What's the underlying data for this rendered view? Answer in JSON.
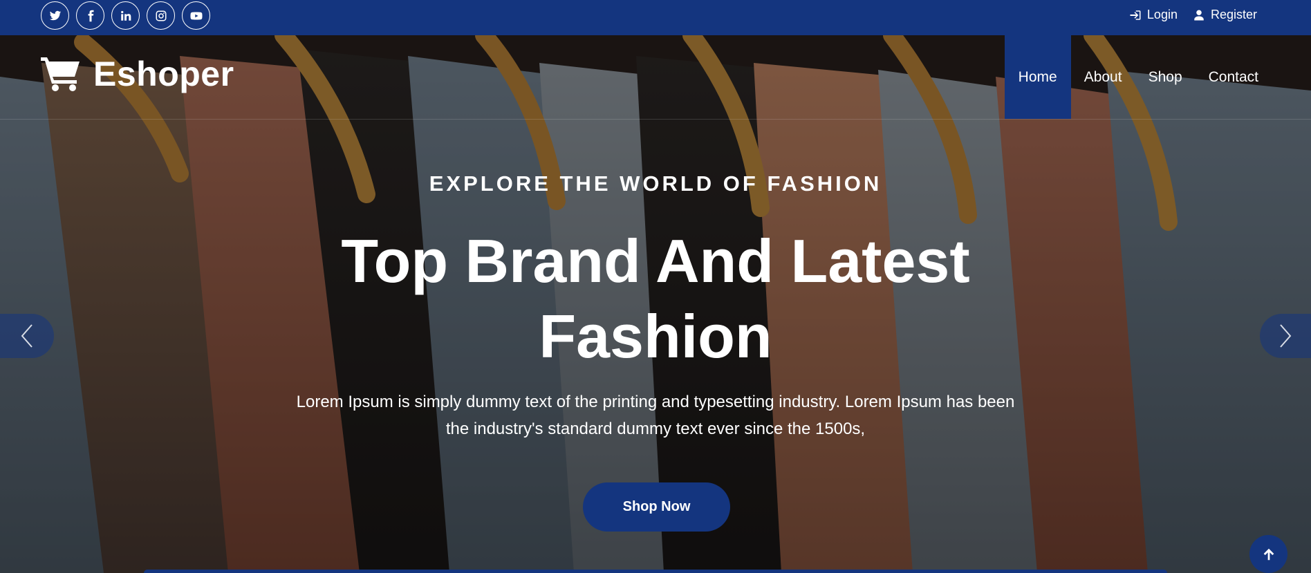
{
  "topbar": {
    "social": [
      {
        "icon": "twitter-icon"
      },
      {
        "icon": "facebook-icon"
      },
      {
        "icon": "linkedin-icon"
      },
      {
        "icon": "instagram-icon"
      },
      {
        "icon": "youtube-icon"
      }
    ],
    "login_label": "Login",
    "register_label": "Register"
  },
  "navbar": {
    "brand": "Eshoper",
    "menu": [
      {
        "label": "Home",
        "active": true
      },
      {
        "label": "About"
      },
      {
        "label": "Shop"
      },
      {
        "label": "Contact"
      }
    ]
  },
  "hero": {
    "kicker": "EXPLORE THE WORLD OF FASHION",
    "headline": "Top Brand And Latest Fashion",
    "description": "Lorem Ipsum is simply dummy text of the printing and typesetting industry. Lorem Ipsum has been the industry's standard dummy text ever since the 1500s,",
    "cta_label": "Shop Now"
  },
  "colors": {
    "primary": "#14357f",
    "text": "#ffffff"
  }
}
